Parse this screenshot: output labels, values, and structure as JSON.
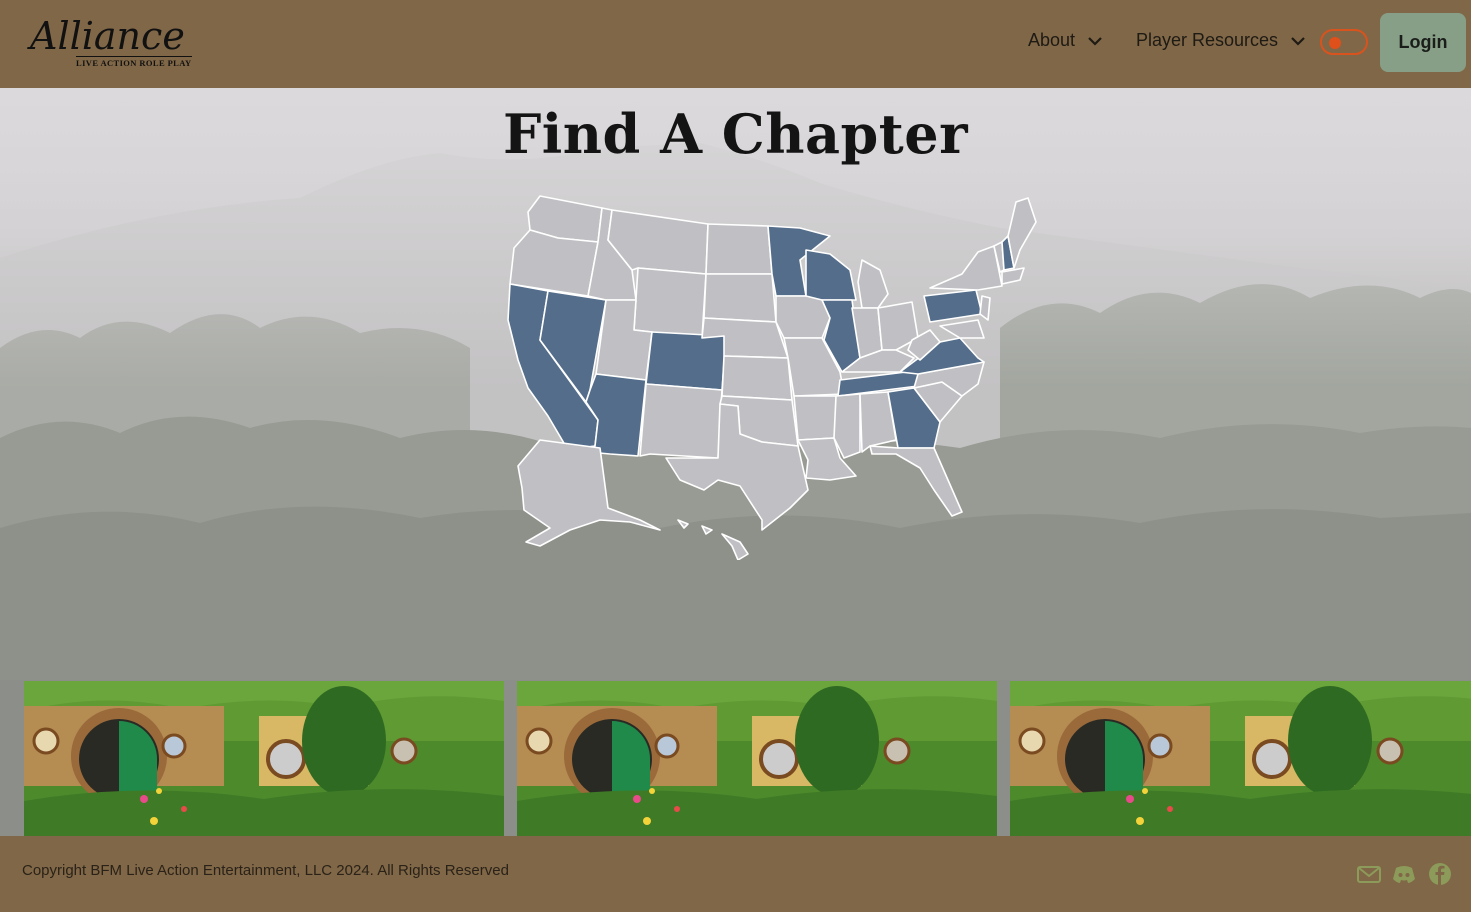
{
  "header": {
    "logo_text": "Alliance",
    "logo_subtitle": "LIVE ACTION ROLE PLAY",
    "nav": [
      {
        "label": "About",
        "icon": "chevron-down-icon"
      },
      {
        "label": "Player Resources",
        "icon": "chevron-down-icon"
      }
    ],
    "theme_toggle_icon": "toggle-switch",
    "login_label": "Login"
  },
  "hero": {
    "title": "Find A Chapter",
    "map_highlighted_states": [
      "CA",
      "NV",
      "AZ",
      "CO",
      "MN",
      "WI",
      "IL",
      "TN",
      "GA",
      "VA",
      "PA",
      "NH"
    ],
    "map_colors": {
      "highlighted": "#536d8a",
      "default": "#c0c0c4"
    }
  },
  "gallery": {
    "images": [
      "hobbit-hole-photo",
      "hobbit-hole-photo",
      "hobbit-hole-photo"
    ]
  },
  "footer": {
    "copyright": "Copyright BFM Live Action Entertainment, LLC 2024. All Rights Reserved",
    "social_icons": [
      "mail-icon",
      "discord-icon",
      "facebook-icon"
    ],
    "icon_color": "#8c9a5a"
  },
  "colors": {
    "header_bg": "#806747",
    "login_bg": "#869f86",
    "toggle_accent": "#e0501a"
  }
}
